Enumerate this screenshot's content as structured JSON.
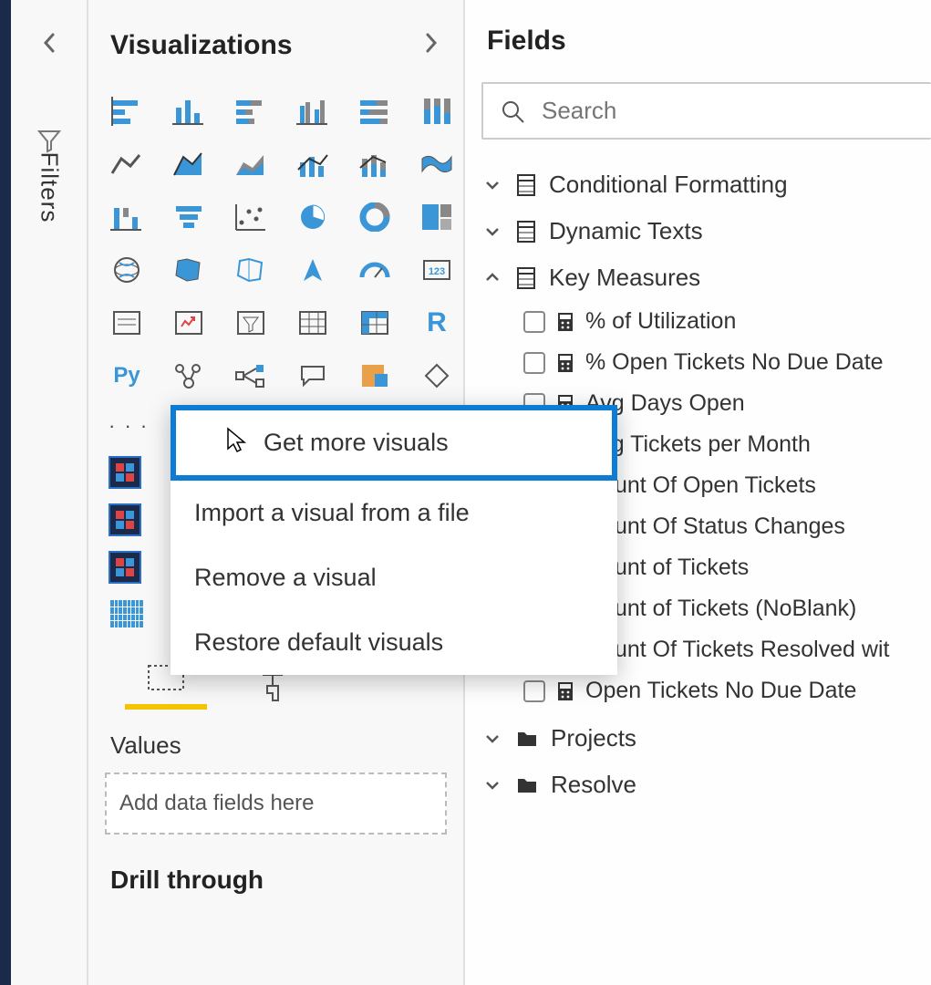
{
  "filters": {
    "label": "Filters"
  },
  "viz": {
    "title": "Visualizations",
    "icons": [
      "stacked-bar",
      "clustered-column",
      "stacked-horizontal",
      "clustered-bar",
      "100-stacked-bar",
      "100-stacked-col",
      "line",
      "area",
      "stacked-area",
      "line-col",
      "line-stacked",
      "ribbon",
      "waterfall",
      "funnel",
      "scatter",
      "pie",
      "donut",
      "treemap",
      "map",
      "filled-map",
      "shape-map",
      "arrow",
      "gauge",
      "card",
      "multi-card",
      "kpi",
      "slicer",
      "table",
      "matrix",
      "r-visual",
      "python",
      "key-influencers",
      "decomposition",
      "qa",
      "ai",
      "shape"
    ],
    "menu": {
      "get_more": "Get more visuals",
      "import": "Import a visual from a file",
      "remove": "Remove a visual",
      "restore": "Restore default visuals"
    },
    "values_label": "Values",
    "drop_placeholder": "Add data fields here",
    "drill_title": "Drill through"
  },
  "fields": {
    "title": "Fields",
    "search_placeholder": "Search",
    "tables": [
      {
        "name": "Conditional Formatting",
        "expanded": false,
        "type": "table"
      },
      {
        "name": "Dynamic Texts",
        "expanded": false,
        "type": "table"
      },
      {
        "name": "Key Measures",
        "expanded": true,
        "type": "table",
        "measures": [
          "% of Utilization",
          "% Open Tickets No Due Date",
          "Avg Days Open",
          "Avg Tickets per Month",
          "Count Of Open Tickets",
          "Count Of Status Changes",
          "Count of Tickets",
          "Count of Tickets (NoBlank)",
          "Count Of Tickets Resolved wit",
          "Open Tickets No Due Date"
        ]
      },
      {
        "name": "Projects",
        "expanded": false,
        "type": "folder"
      },
      {
        "name": "Resolve",
        "expanded": false,
        "type": "folder"
      }
    ]
  },
  "labels": {
    "r": "R",
    "py": "Py"
  }
}
